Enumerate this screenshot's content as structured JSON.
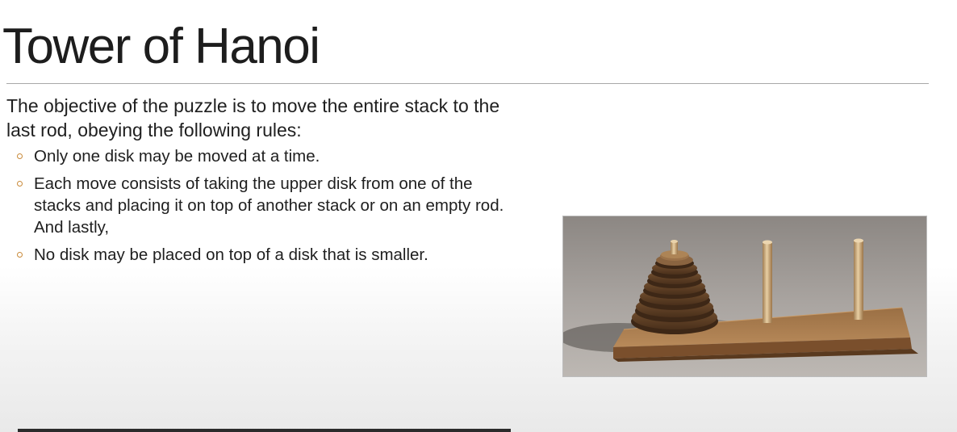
{
  "slide": {
    "title": "Tower of Hanoi",
    "intro": "The objective of the puzzle is to move the entire stack to the last rod, obeying the following rules:",
    "rules": [
      "Only one disk may be moved at a time.",
      "Each move consists of taking the upper disk from one of the stacks and placing it on top of another stack or on an empty rod. And lastly,",
      "No disk may be placed on top of a disk that is smaller."
    ],
    "bullet_color": "#c98a3a"
  },
  "image": {
    "icon": "tower-of-hanoi-photo"
  }
}
